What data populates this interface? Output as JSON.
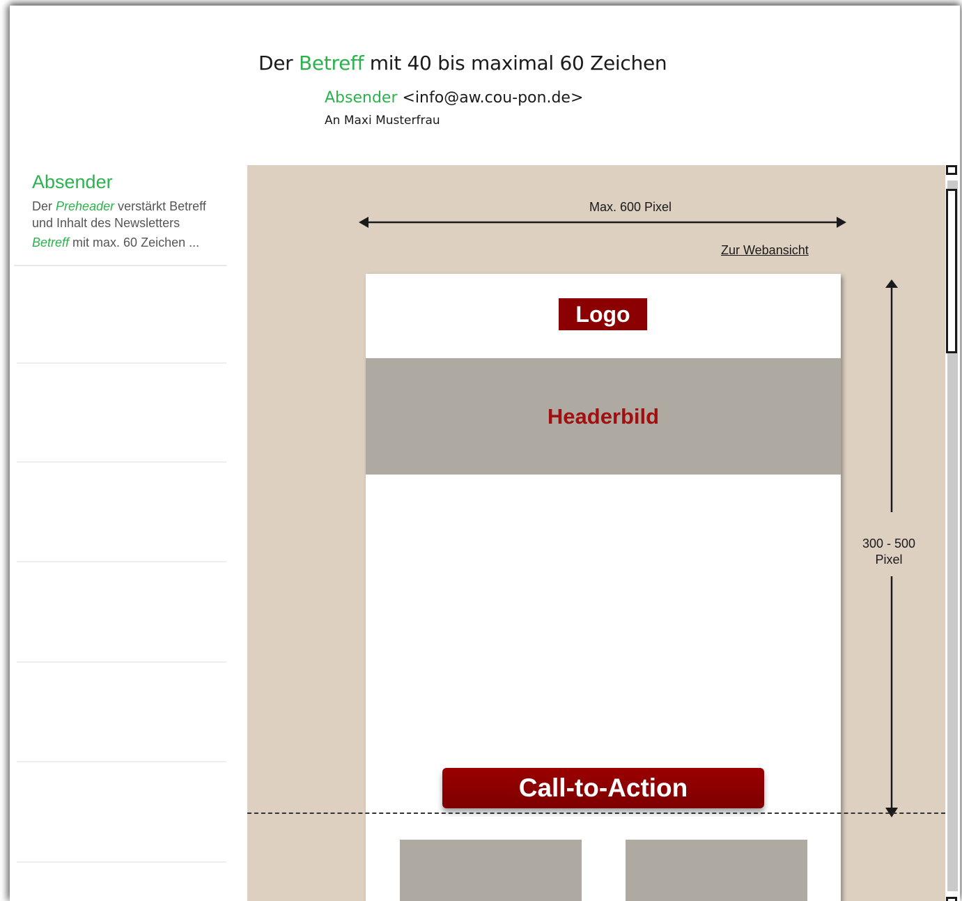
{
  "email_header": {
    "subject_prefix": "Der",
    "subject_highlight": "Betreff",
    "subject_suffix": "mit 40 bis maximal 60 Zeichen",
    "sender_name": "Absender",
    "sender_address": "<info@aw.cou-pon.de>",
    "to_label": "An",
    "to_name": "Maxi Musterfrau"
  },
  "inbox": {
    "first_item": {
      "sender": "Absender",
      "preheader_prefix": "Der",
      "preheader_highlight": "Preheader",
      "preheader_suffix": "verstärkt Betreff und Inhalt des Newsletters",
      "subject_highlight": "Betreff",
      "subject_suffix": "mit max. 60 Zeichen ..."
    }
  },
  "preview": {
    "width_label": "Max. 600 Pixel",
    "webview_link": "Zur Webansicht",
    "logo_label": "Logo",
    "header_image_label": "Headerbild",
    "cta_label": "Call-to-Action",
    "height_label_line1": "300 - 500",
    "height_label_line2": "Pixel"
  },
  "colors": {
    "accent_green": "#2bb24c",
    "brand_red": "#8b0000",
    "preview_background": "#ddd0c1",
    "placeholder_gray": "#aea9a1"
  }
}
